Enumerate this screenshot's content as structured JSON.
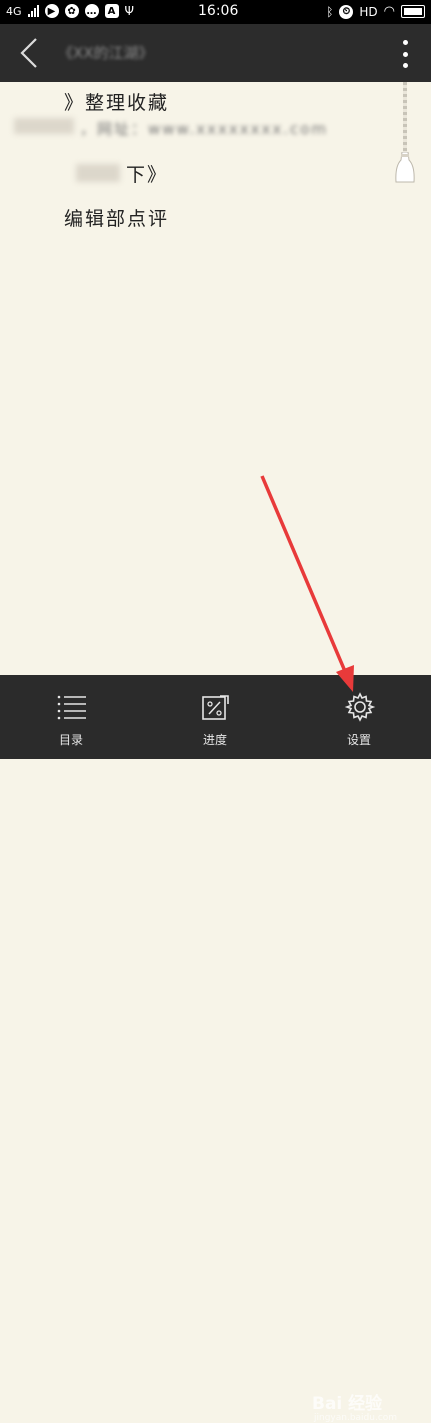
{
  "status_bar": {
    "network": "4G",
    "time": "16:06",
    "hd": "HD"
  },
  "header": {
    "book_title": "《XX的江湖》"
  },
  "content": {
    "line1": "》整理收藏",
    "line2_blurred": "，网址：www.xxxxxxxx.com",
    "line3": "下》",
    "line4": "编辑部点评"
  },
  "bottom_bar": {
    "items": [
      {
        "label": "目录",
        "icon": "toc-list-icon"
      },
      {
        "label": "进度",
        "icon": "progress-percent-icon"
      },
      {
        "label": "设置",
        "icon": "settings-gear-icon"
      }
    ]
  },
  "watermark": {
    "text": "Bai 经验",
    "url": "jingyan.baidu.com"
  },
  "colors": {
    "page_bg": "#f7f4e8",
    "topbar": "#2c2c2c",
    "bottombar": "#2b2b2b",
    "annotation_arrow": "#e83a3a"
  }
}
